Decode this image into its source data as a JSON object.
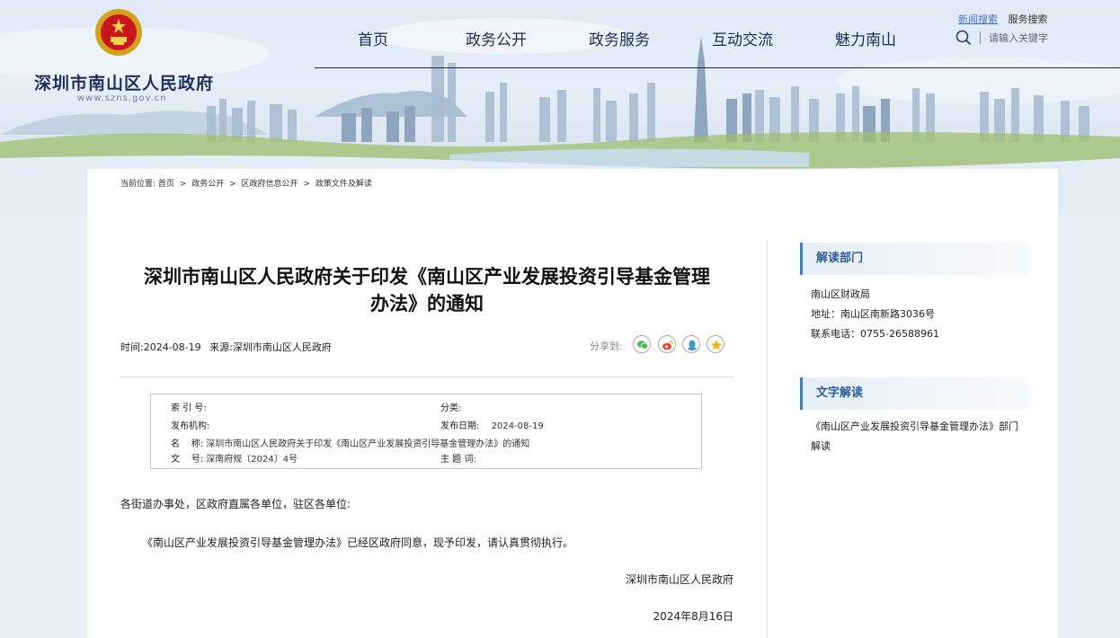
{
  "header": {
    "site_name": "深圳市南山区人民政府",
    "site_url": "www.szns.gov.cn",
    "nav": [
      "首页",
      "政务公开",
      "政务服务",
      "互动交流",
      "魅力南山"
    ],
    "top_links": {
      "news_search": "新闻搜索",
      "service_search": "服务搜索"
    },
    "search": {
      "placeholder": "请输入关键字"
    }
  },
  "breadcrumb": {
    "label": "当前位置:",
    "items": [
      "首页",
      "政务公开",
      "区政府信息公开",
      "政策文件及解读"
    ],
    "separator": ">"
  },
  "article": {
    "title_line1": "深圳市南山区人民政府关于印发《南山区产业发展投资引导基金管理",
    "title_line2": "办法》的通知",
    "time_label": "时间:",
    "time": "2024-08-19",
    "source_label": "来源:",
    "source": "深圳市南山区人民政府",
    "share_label": "分享到:",
    "share_icons": [
      "wechat-icon",
      "weibo-icon",
      "qq-icon",
      "qzone-icon"
    ],
    "info": {
      "index_key": "索 引 号:",
      "index_val": "",
      "category_key": "分类:",
      "category_val": "",
      "issuer_key": "发布机构:",
      "issuer_val": "",
      "pubdate_key": "发布日期:",
      "pubdate_val": "2024-08-19",
      "name_key": "名    称:",
      "name_val": "深圳市南山区人民政府关于印发《南山区产业发展投资引导基金管理办法》的通知",
      "docno_key": "文    号:",
      "docno_val": "深南府规〔2024〕4号",
      "subject_key": "主 题 词:",
      "subject_val": ""
    },
    "salutation": "各街道办事处，区政府直属各单位，驻区各单位:",
    "paragraph": "《南山区产业发展投资引导基金管理办法》已经区政府同意，现予印发，请认真贯彻执行。",
    "signature": "深圳市南山区人民政府",
    "date": "2024年8月16日"
  },
  "sidebar": {
    "dept_title": "解读部门",
    "dept_name": "南山区财政局",
    "address": "地址：南山区南新路3036号",
    "phone": "联系电话：0755-26588961",
    "text_title": "文字解读",
    "text_link": "《南山区产业发展投资引导基金管理办法》部门解读"
  },
  "colors": {
    "nav_text": "#1e2c55",
    "side_accent": "#3f7cc6",
    "link_blue": "#4a72c4"
  }
}
